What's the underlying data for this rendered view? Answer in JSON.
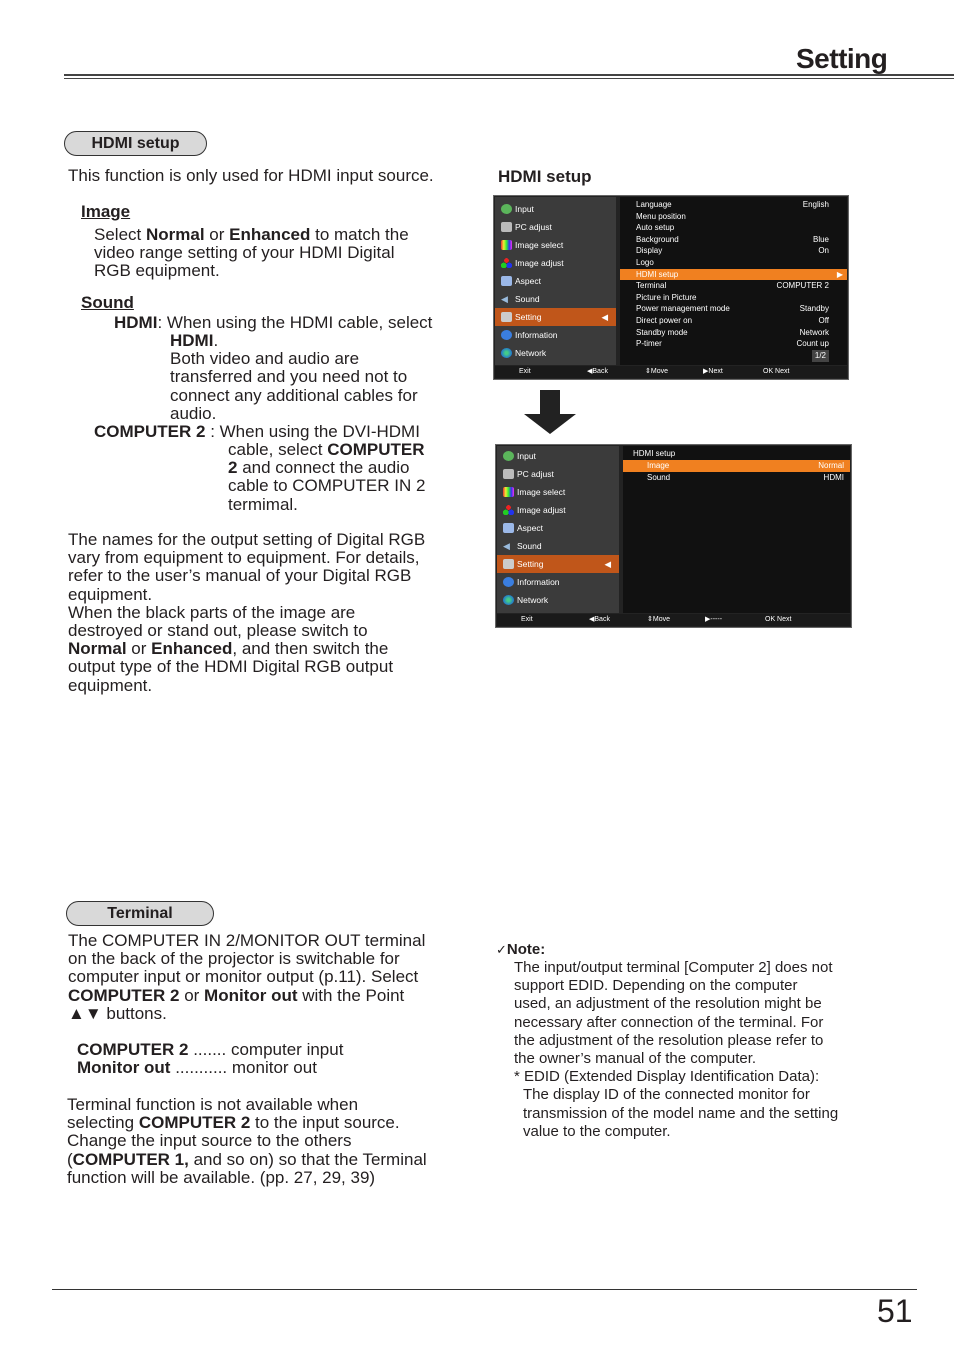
{
  "header": {
    "title": "Setting"
  },
  "hdmi_section": {
    "pill": "HDMI setup",
    "intro": "This function is only used for HDMI input source.",
    "image": {
      "heading": "Image",
      "t1": "Select ",
      "b1": "Normal",
      "t2": " or ",
      "b2": "Enhanced",
      "t3": " to match the",
      "line2": "video range setting of your HDMI Digital",
      "line3": "RGB equipment."
    },
    "sound": {
      "heading": "Sound",
      "hdmi_term": "HDMI",
      "hdmi_l1": ": When using the HDMI cable, select",
      "hdmi_l2b": "HDMI",
      "hdmi_l2": ".",
      "hdmi_l3": "Both video and audio are",
      "hdmi_l4": "transferred and you need not to",
      "hdmi_l5": "connect any additional cables for",
      "hdmi_l6": "audio.",
      "comp_term": "COMPUTER 2",
      "comp_l1": " : When using the DVI-HDMI",
      "comp_l2": "cable, select ",
      "comp_l2b": "COMPUTER",
      "comp_l3b": "2",
      "comp_l3": " and connect the audio",
      "comp_l4": "cable to COMPUTER IN 2",
      "comp_l5": "termimal."
    },
    "para1": [
      "The names for the output setting of Digital RGB",
      "vary from equipment to equipment. For details,",
      "refer to the user’s manual of your Digital RGB",
      "equipment.",
      "When the black parts of the image are",
      "destroyed or stand out, please switch to"
    ],
    "para1_last": {
      "b1": "Normal",
      "t1": " or ",
      "b2": "Enhanced",
      "t2": ", and then switch the"
    },
    "para1_tail": [
      "output type of the HDMI Digital RGB output",
      "equipment."
    ],
    "screen_caption": "HDMI setup"
  },
  "osd1": {
    "menu": [
      "Input",
      "PC adjust",
      "Image select",
      "Image adjust",
      "Aspect",
      "Sound",
      "Setting",
      "Information",
      "Network"
    ],
    "selected_menu": "Setting",
    "rows": [
      {
        "k": "Language",
        "v": "English"
      },
      {
        "k": "Menu position",
        "v": ""
      },
      {
        "k": "Auto setup",
        "v": ""
      },
      {
        "k": "Background",
        "v": "Blue"
      },
      {
        "k": "Display",
        "v": "On"
      },
      {
        "k": "Logo",
        "v": ""
      },
      {
        "k": "HDMI setup",
        "v": "▶"
      },
      {
        "k": "Terminal",
        "v": "COMPUTER 2"
      },
      {
        "k": "Picture in Picture",
        "v": ""
      },
      {
        "k": "Power management mode",
        "v": "Standby"
      },
      {
        "k": "Direct power on",
        "v": "Off"
      },
      {
        "k": "Standby mode",
        "v": "Network"
      },
      {
        "k": "P-timer",
        "v": "Count up"
      }
    ],
    "page": "1/2",
    "footer": [
      "Exit",
      "◀Back",
      "⇕Move",
      "▶Next",
      "OK Next"
    ]
  },
  "osd2": {
    "menu": [
      "Input",
      "PC adjust",
      "Image select",
      "Image adjust",
      "Aspect",
      "Sound",
      "Setting",
      "Information",
      "Network"
    ],
    "title": "HDMI setup",
    "rows": [
      {
        "k": "Image",
        "v": "Normal"
      },
      {
        "k": "Sound",
        "v": "HDMI"
      }
    ],
    "footer": [
      "Exit",
      "◀Back",
      "⇕Move",
      "▶-----",
      "OK Next"
    ]
  },
  "terminal_section": {
    "pill": "Terminal",
    "p1": [
      "The COMPUTER IN 2/MONITOR OUT terminal",
      "on the back of the projector is switchable for",
      "computer input or monitor output (p.11). Select"
    ],
    "p1_b1": "COMPUTER 2",
    "p1_t1": " or ",
    "p1_b2": "Monitor out",
    "p1_t2": " with the Point",
    "p1_last": "▲▼ buttons.",
    "opt1_b": "COMPUTER 2",
    "opt1_t": " ....... computer input",
    "opt2_b": "Monitor out",
    "opt2_t": " ........... monitor out",
    "p2_l1": "Terminal function is not available when",
    "p2_l2a": "selecting ",
    "p2_l2b": "COMPUTER 2",
    "p2_l2c": " to the input source.",
    "p2_l3": "Change the input source to the others",
    "p2_l4a": "(",
    "p2_l4b": "COMPUTER 1,",
    "p2_l4c": " and so on) so that the Terminal",
    "p2_l5": "function will be available. (pp. 27, 29, 39)"
  },
  "note": {
    "check": "✓",
    "heading": "Note:",
    "lines": [
      "The input/output terminal [Computer 2] does not",
      "support EDID. Depending on the computer",
      "used, an adjustment of the resolution might be",
      "necessary after connection of the terminal. For",
      "the adjustment of the resolution please refer to",
      "the owner’s manual of the computer."
    ],
    "foot": [
      "* EDID (Extended Display Identification Data):",
      "The display ID of the connected monitor for",
      "transmission of the model name and the setting",
      "value to the computer."
    ]
  },
  "page_number": "51"
}
